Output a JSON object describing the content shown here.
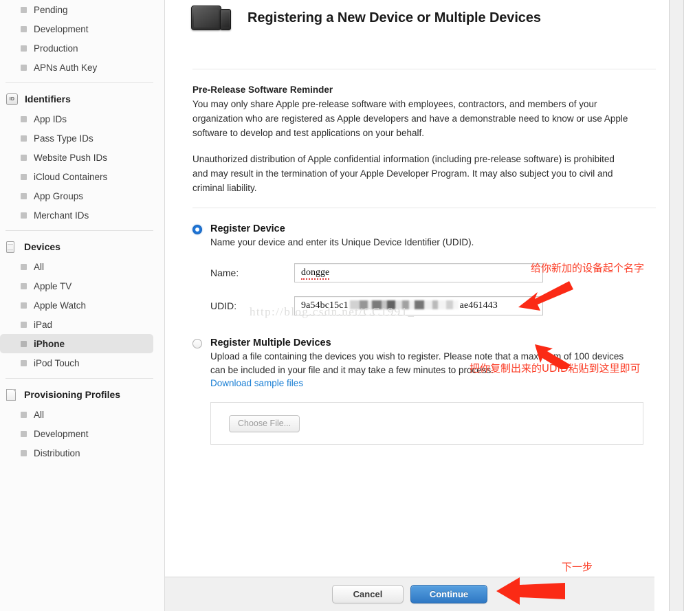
{
  "sidebar": {
    "groups": [
      {
        "header": null,
        "items": [
          {
            "label": "Pending",
            "selected": false
          },
          {
            "label": "Development",
            "selected": false
          },
          {
            "label": "Production",
            "selected": false
          },
          {
            "label": "APNs Auth Key",
            "selected": false
          }
        ]
      },
      {
        "header": {
          "label": "Identifiers",
          "icon": "id-badge-icon"
        },
        "items": [
          {
            "label": "App IDs",
            "selected": false
          },
          {
            "label": "Pass Type IDs",
            "selected": false
          },
          {
            "label": "Website Push IDs",
            "selected": false
          },
          {
            "label": "iCloud Containers",
            "selected": false
          },
          {
            "label": "App Groups",
            "selected": false
          },
          {
            "label": "Merchant IDs",
            "selected": false
          }
        ]
      },
      {
        "header": {
          "label": "Devices",
          "icon": "phone-icon"
        },
        "items": [
          {
            "label": "All",
            "selected": false
          },
          {
            "label": "Apple TV",
            "selected": false
          },
          {
            "label": "Apple Watch",
            "selected": false
          },
          {
            "label": "iPad",
            "selected": false
          },
          {
            "label": "iPhone",
            "selected": true
          },
          {
            "label": "iPod Touch",
            "selected": false
          }
        ]
      },
      {
        "header": {
          "label": "Provisioning Profiles",
          "icon": "document-icon"
        },
        "items": [
          {
            "label": "All",
            "selected": false
          },
          {
            "label": "Development",
            "selected": false
          },
          {
            "label": "Distribution",
            "selected": false
          }
        ]
      }
    ],
    "id_badge_text": "ID"
  },
  "header": {
    "title": "Registering a New Device or Multiple Devices",
    "icon": "ipad-iphone-icon"
  },
  "notice": {
    "heading": "Pre-Release Software Reminder",
    "paragraph1": "You may only share Apple pre-release software with employees, contractors, and members of your organization who are registered as Apple developers and have a demonstrable need to know or use Apple software to develop and test applications on your behalf.",
    "paragraph2": "Unauthorized distribution of Apple confidential information (including pre-release software) is prohibited and may result in the termination of your Apple Developer Program. It may also subject you to civil and criminal liability."
  },
  "register_device": {
    "selected": true,
    "title": "Register Device",
    "description": "Name your device and enter its Unique Device Identifier (UDID).",
    "name_label": "Name:",
    "name_value": "dongge",
    "name_placeholder": "",
    "udid_label": "UDID:",
    "udid_prefix": "9a54bc15c1",
    "udid_suffix": "ae461443",
    "udid_placeholder": ""
  },
  "register_multiple": {
    "selected": false,
    "title": "Register Multiple Devices",
    "description": "Upload a file containing the devices you wish to register. Please note that a maximum of 100 devices can be included in your file and it may take a few minutes to process.",
    "download_link": "Download sample files",
    "choose_file_label": "Choose File..."
  },
  "footer": {
    "cancel_label": "Cancel",
    "continue_label": "Continue"
  },
  "annotations": [
    {
      "text": "给你新加的设备起个名字",
      "target": "name-field"
    },
    {
      "text": "把你复制出来的UDID粘贴到这里即可",
      "target": "udid-field"
    },
    {
      "text": "下一步",
      "target": "continue-button"
    }
  ],
  "watermark": "http://blog.csdn.net/CC1991_",
  "colors": {
    "accent_blue": "#2f78c4",
    "link_blue": "#1a7fd4",
    "annotation_red": "#fb3b24",
    "radio_blue": "#1d74d6",
    "selected_row": "#e4e4e4"
  }
}
